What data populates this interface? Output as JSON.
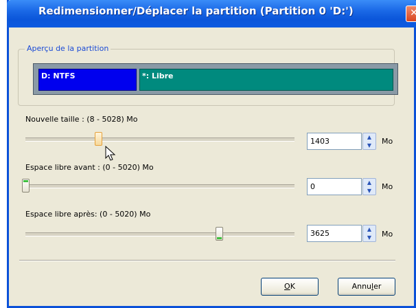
{
  "window": {
    "title": "Redimensionner/Déplacer la partition (Partition 0 'D:')",
    "close_icon": "close-icon"
  },
  "preview": {
    "legend": "Aperçu de la partition",
    "segments": [
      {
        "label": "D: NTFS",
        "color": "#0000ee"
      },
      {
        "label": "*: Libre",
        "color": "#008a7e"
      }
    ]
  },
  "sliders": [
    {
      "label": "Nouvelle taille : (8 - 5028) Mo",
      "value": "1403",
      "unit": "Mo",
      "position": 0.27
    },
    {
      "label": "Espace libre avant : (0 - 5020) Mo",
      "value": "0",
      "unit": "Mo",
      "position": 0.0
    },
    {
      "label": "Espace libre après: (0 - 5020) Mo",
      "value": "3625",
      "unit": "Mo",
      "position": 0.72
    }
  ],
  "buttons": {
    "ok_accel": "O",
    "ok_rest": "K",
    "cancel_pre": "Annu",
    "cancel_accel": "l",
    "cancel_rest": "er"
  }
}
